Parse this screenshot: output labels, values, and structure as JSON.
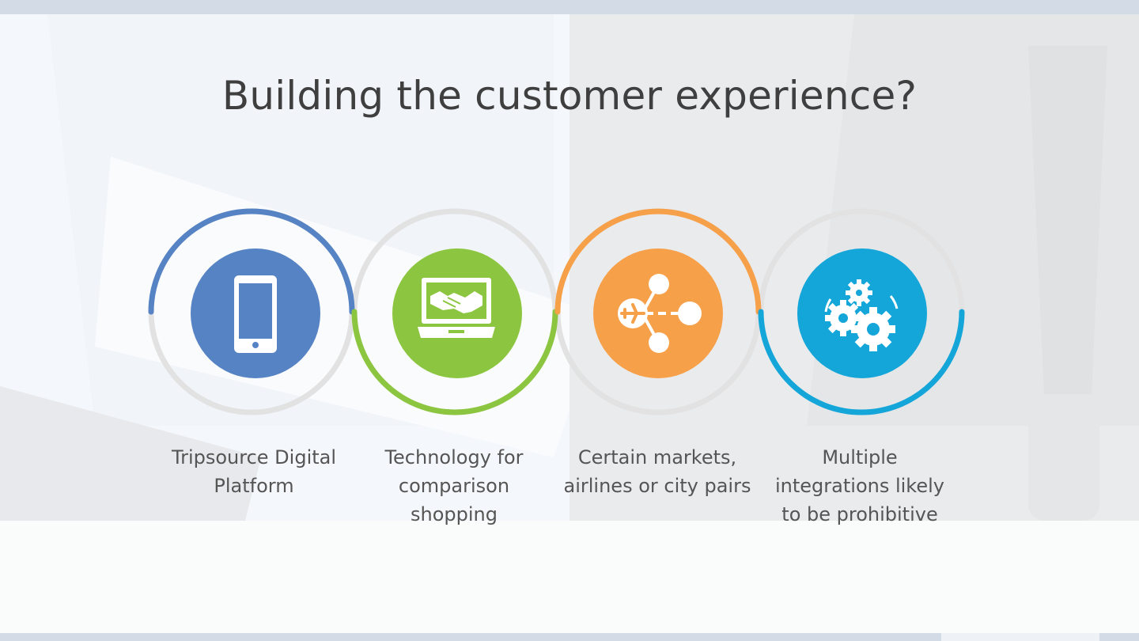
{
  "slide": {
    "title": "Building the customer experience?",
    "accent_colors": {
      "blue": "#5683c4",
      "green": "#8cc53f",
      "orange": "#f7a04a",
      "cyan": "#14a6d9",
      "ring_gray": "#e3e3e3"
    },
    "items": [
      {
        "icon": "smartphone-icon",
        "color": "#5683c4",
        "caption_line1": "Tripsource Digital",
        "caption_line2": "Platform",
        "caption_line3": ""
      },
      {
        "icon": "handshake-laptop-icon",
        "color": "#8cc53f",
        "caption_line1": "Technology for",
        "caption_line2": "comparison",
        "caption_line3": "shopping"
      },
      {
        "icon": "flight-network-icon",
        "color": "#f7a04a",
        "caption_line1": "Certain markets,",
        "caption_line2": "airlines or city pairs",
        "caption_line3": ""
      },
      {
        "icon": "gears-icon",
        "color": "#14a6d9",
        "caption_line1": "Multiple",
        "caption_line2": "integrations likely",
        "caption_line3": "to be prohibitive"
      }
    ]
  }
}
